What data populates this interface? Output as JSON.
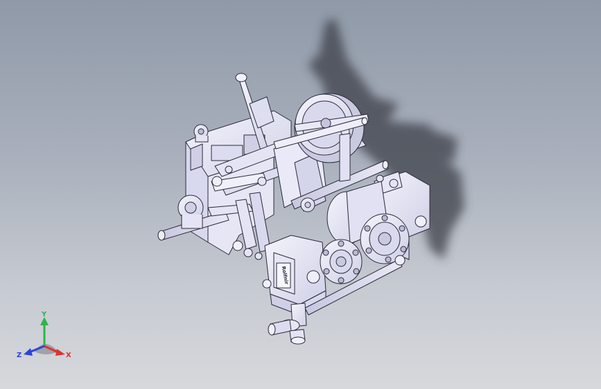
{
  "viewport": {
    "background_top": "#8f99a8",
    "background_bottom": "#d6d8dc",
    "part_color": "#e4e4f4",
    "edge_color": "#2a2a3a",
    "shadow_color": "#3c3f48"
  },
  "model": {
    "nameplate_text": "Rolfnir"
  },
  "triad": {
    "x_label": "X",
    "y_label": "Y",
    "z_label": "Z",
    "x_color": "#e03030",
    "y_color": "#2fb34a",
    "z_color": "#2a44d8"
  }
}
